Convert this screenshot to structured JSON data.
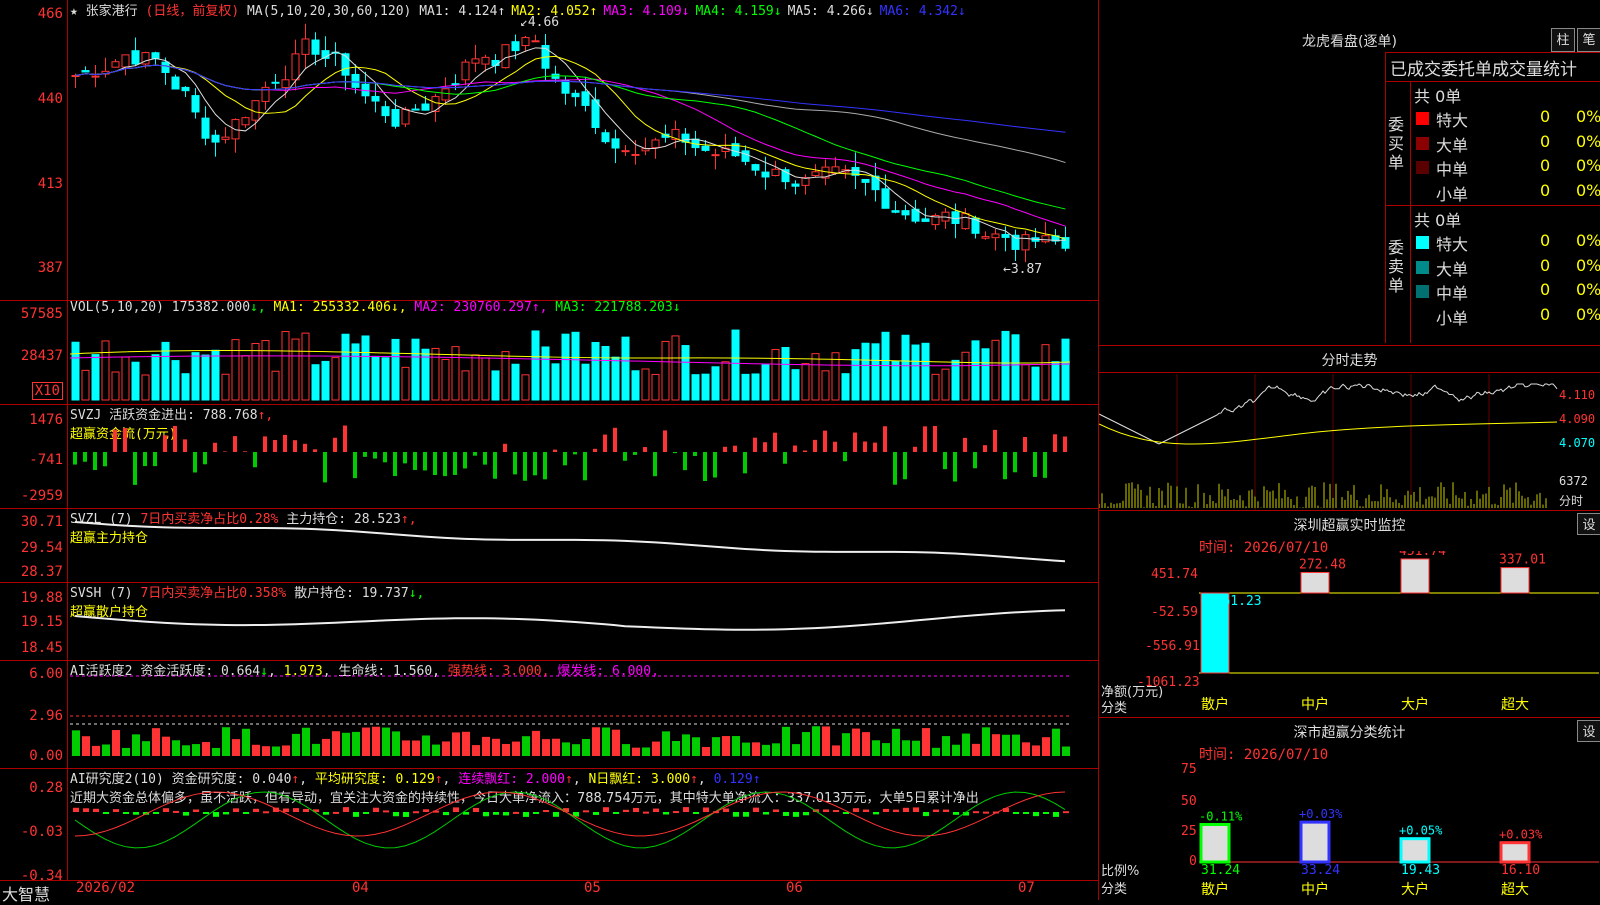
{
  "stock": {
    "name": "张家港行",
    "period": "(日线，前复权)",
    "star": "★"
  },
  "ma": {
    "label": "MA(5,10,20,30,60,120)",
    "items": [
      {
        "label": "MA1: 4.124",
        "arrow": "↑",
        "color": "#dddddd"
      },
      {
        "label": "MA2: 4.052",
        "arrow": "↑",
        "color": "#ffff00"
      },
      {
        "label": "MA3: 4.109",
        "arrow": "↓",
        "color": "#ff00ff"
      },
      {
        "label": "MA4: 4.159",
        "arrow": "↓",
        "color": "#00ff00"
      },
      {
        "label": "MA5: 4.266",
        "arrow": "↓",
        "color": "#dddddd"
      },
      {
        "label": "MA6: 4.342",
        "arrow": "↓",
        "color": "#3333ff"
      }
    ]
  },
  "price_axis": [
    "466",
    "440",
    "413",
    "387"
  ],
  "price_annot": {
    "high": "4.66",
    "low": "3.87"
  },
  "vol": {
    "title": "VOL(5,10,20)",
    "value": "175382.000",
    "ma1": "MA1: 255332.406",
    "ma2": "MA2: 230760.297",
    "ma3": "MA3: 221788.203",
    "axis": [
      "57585",
      "28437"
    ],
    "unit": "X10"
  },
  "svzj": {
    "title": "SVZJ",
    "label": "活跃资金进出: 788.768",
    "arrow": "↑,",
    "sub": "超赢资金流(万元)",
    "axis": [
      "1476",
      "-741",
      "-2959"
    ]
  },
  "svzl": {
    "title": "SVZL (7)",
    "ratio": "7日内买卖净占比0.28%",
    "label": "主力持仓: 28.523",
    "arrow": "↑,",
    "sub": "超赢主力持仓",
    "axis": [
      "30.71",
      "29.54",
      "28.37"
    ]
  },
  "svsh": {
    "title": "SVSH (7)",
    "ratio": "7日内买卖净占比0.358%",
    "label": "散户持仓: 19.737",
    "arrow": "↓,",
    "sub": "超赢散户持仓",
    "axis": [
      "19.88",
      "19.15",
      "18.45"
    ]
  },
  "ai_active": {
    "title": "AI活跃度2",
    "label": "资金活跃度: 0.664",
    "v2": "1.973",
    "life": "生命线: 1.560,",
    "strong": "强势线: 3.000,",
    "burst": "爆发线: 6.000,",
    "axis": [
      "6.00",
      "2.96",
      "0.00"
    ]
  },
  "ai_research": {
    "title": "AI研究度2(10)",
    "label": "资金研究度: 0.040",
    "avg": "平均研究度: 0.129",
    "cont": "连续飘红: 2.000",
    "nday": "N日飘红: 3.000",
    "last": "0.129",
    "comment": "近期大资金总体偏多，虽不活跃，但有异动，宜关注大资金的持续性，今日大单净流入：788.754万元，其中特大单净流入：337.013万元，大单5日累计净出",
    "axis": [
      "0.28",
      "-0.03",
      "-0.34"
    ]
  },
  "xaxis": {
    "brand": "大智慧",
    "labels": [
      "2026/02",
      "04",
      "05",
      "06",
      "07"
    ]
  },
  "right": {
    "lhkp_title": "龙虎看盘(逐单)",
    "btn_zhu": "柱",
    "btn_bi": "笔",
    "stats_title": "已成交委托单成交量统计",
    "buy_label": "委买单",
    "sell_label": "委卖单",
    "buy_total": "共 0单",
    "sell_total": "共 0单",
    "buy_rows": [
      {
        "name": "特大",
        "count": "0",
        "pct": "0%",
        "color": "#ff0000"
      },
      {
        "name": "大单",
        "count": "0",
        "pct": "0%",
        "color": "#8b0000"
      },
      {
        "name": "中单",
        "count": "0",
        "pct": "0%",
        "color": "#5a0000"
      },
      {
        "name": "小单",
        "count": "0",
        "pct": "0%",
        "color": "#000000"
      }
    ],
    "sell_rows": [
      {
        "name": "特大",
        "count": "0",
        "pct": "0%",
        "color": "#00ffff"
      },
      {
        "name": "大单",
        "count": "0",
        "pct": "0%",
        "color": "#008b8b"
      },
      {
        "name": "中单",
        "count": "0",
        "pct": "0%",
        "color": "#007070"
      },
      {
        "name": "小单",
        "count": "0",
        "pct": "0%",
        "color": "#000000"
      }
    ],
    "intraday_title": "分时走势",
    "intraday_axis": [
      "4.110",
      "4.090",
      "4.070"
    ],
    "intraday_vol": "6372",
    "intraday_unit": "分时",
    "sz_title": "深圳超赢实时监控",
    "sz_set": "设",
    "sz_time": "时间: 2026/07/10",
    "sz_axis": [
      "451.74",
      "-52.59",
      "-556.91",
      "-1061.23"
    ],
    "sz_ylabel": "净额(万元)",
    "sz_xlabel": "分类",
    "sz_cats": [
      "散户",
      "中户",
      "大户",
      "超大"
    ],
    "sz_vals": [
      "-1061.23",
      "272.48",
      "451.74",
      "337.01"
    ],
    "cls_title": "深市超赢分类统计",
    "cls_set": "设",
    "cls_time": "时间: 2026/07/10",
    "cls_axis": [
      "75",
      "50",
      "25",
      "0"
    ],
    "cls_ylabel": "比例%",
    "cls_xlabel": "分类",
    "cls_changes": [
      "-0.11%",
      "+0.03%",
      "+0.05%",
      "+0.03%"
    ],
    "cls_vals": [
      "31.24",
      "33.24",
      "19.43",
      "16.10"
    ],
    "cls_cats": [
      "散户",
      "中户",
      "大户",
      "超大"
    ]
  }
}
